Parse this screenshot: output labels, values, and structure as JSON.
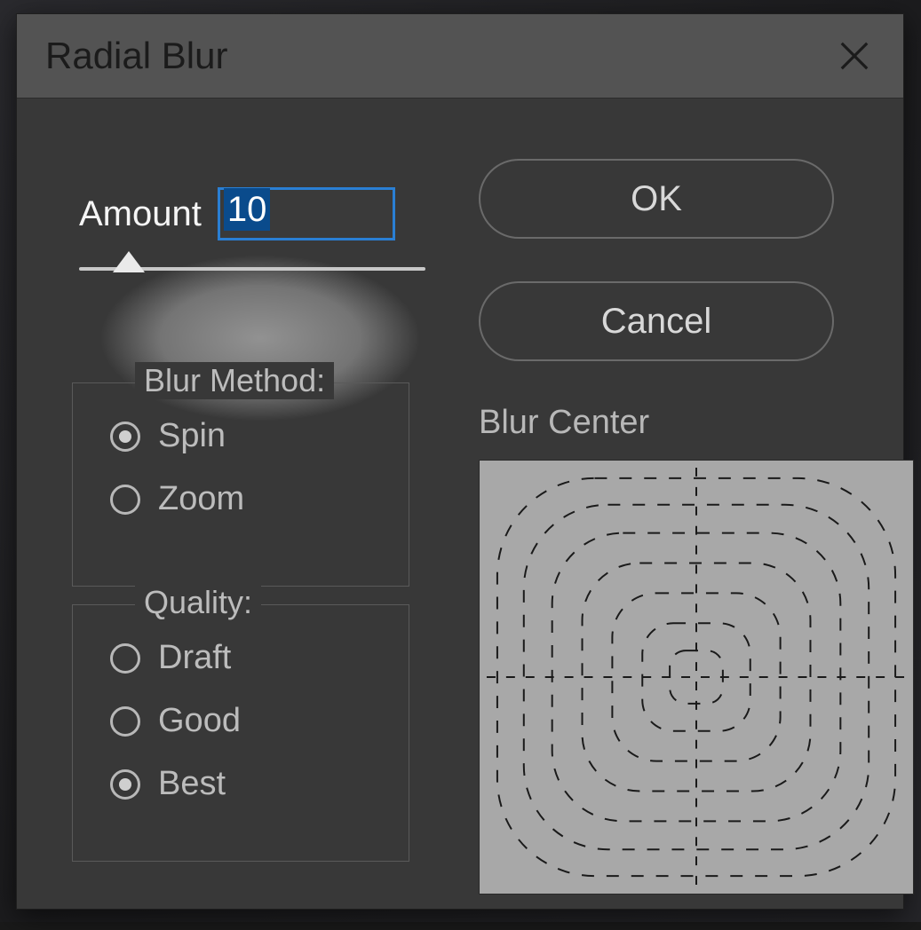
{
  "dialog": {
    "title": "Radial Blur",
    "amount": {
      "label": "Amount",
      "value": "10",
      "slider_position_percent": 10
    },
    "method": {
      "legend": "Blur Method:",
      "options": [
        "Spin",
        "Zoom"
      ],
      "selected": "Spin"
    },
    "quality": {
      "legend": "Quality:",
      "options": [
        "Draft",
        "Good",
        "Best"
      ],
      "selected": "Best"
    },
    "center": {
      "label": "Blur Center"
    },
    "buttons": {
      "ok": "OK",
      "cancel": "Cancel"
    }
  }
}
